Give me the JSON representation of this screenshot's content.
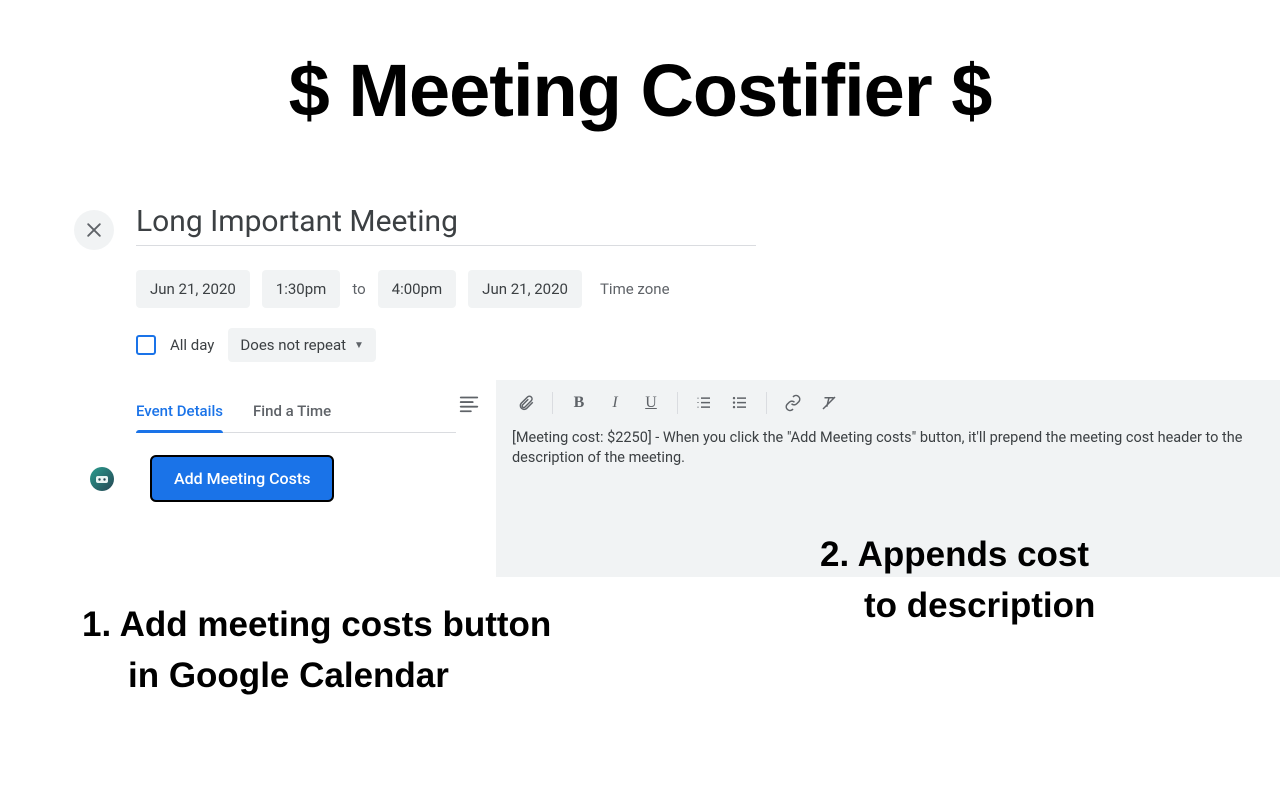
{
  "promo": {
    "title": "$ Meeting Costifier $",
    "anno1_line1": "1. Add meeting costs button",
    "anno1_line2": "in Google Calendar",
    "anno2_line1": "2. Appends cost",
    "anno2_line2": "to description"
  },
  "event": {
    "title": "Long Important Meeting",
    "start_date": "Jun 21, 2020",
    "start_time": "1:30pm",
    "to_label": "to",
    "end_time": "4:00pm",
    "end_date": "Jun 21, 2020",
    "timezone_label": "Time zone",
    "all_day_label": "All day",
    "all_day_checked": false,
    "repeat_label": "Does not repeat",
    "tabs": {
      "details": "Event Details",
      "findtime": "Find a Time",
      "active": "details"
    },
    "add_costs_button": "Add Meeting Costs",
    "description": "[Meeting cost: $2250] - When you click the \"Add Meeting costs\" button, it'll prepend the meeting cost header to the description of the meeting."
  },
  "icons": {
    "close": "close-icon",
    "align": "format-align-left-icon",
    "attach": "attachment-icon",
    "bold": "bold-icon",
    "italic": "italic-icon",
    "underline": "underline-icon",
    "numlist": "numbered-list-icon",
    "bulletlist": "bulleted-list-icon",
    "link": "link-icon",
    "clear": "clear-format-icon",
    "caret": "chevron-down-icon",
    "avatar": "extension-avatar"
  },
  "colors": {
    "primary": "#1a73e8",
    "chip_bg": "#f1f3f4",
    "text_muted": "#5f6368"
  }
}
